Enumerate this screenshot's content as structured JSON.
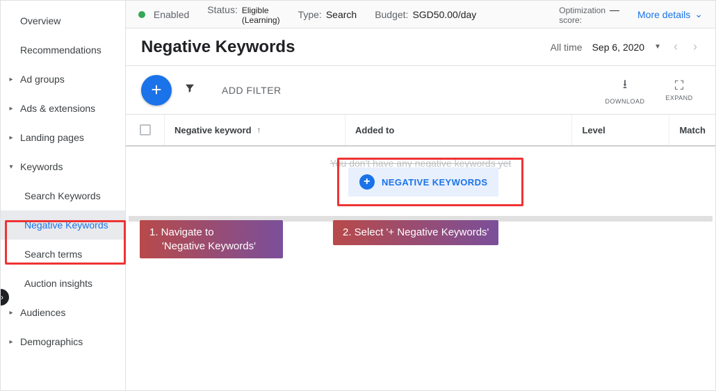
{
  "sidebar": {
    "items": [
      {
        "label": "Overview",
        "chevron": ""
      },
      {
        "label": "Recommendations",
        "chevron": ""
      },
      {
        "label": "Ad groups",
        "chevron": "▸"
      },
      {
        "label": "Ads & extensions",
        "chevron": "▸"
      },
      {
        "label": "Landing pages",
        "chevron": "▸"
      },
      {
        "label": "Keywords",
        "chevron": "▾"
      },
      {
        "label": "Search Keywords",
        "chevron": "",
        "sub": true
      },
      {
        "label": "Negative Keywords",
        "chevron": "",
        "sub": true,
        "active": true
      },
      {
        "label": "Search terms",
        "chevron": "",
        "sub": true
      },
      {
        "label": "Auction insights",
        "chevron": "",
        "sub": true
      },
      {
        "label": "Audiences",
        "chevron": "▸"
      },
      {
        "label": "Demographics",
        "chevron": "▸"
      }
    ]
  },
  "statusbar": {
    "enabled": "Enabled",
    "status_label": "Status:",
    "status_top": "Eligible",
    "status_bottom": "(Learning)",
    "type_label": "Type:",
    "type_value": "Search",
    "budget_label": "Budget:",
    "budget_value": "SGD50.00/day",
    "opt_top": "Optimization",
    "opt_bottom": "score:",
    "opt_dash": "—",
    "more": "More details"
  },
  "header": {
    "title": "Negative Keywords",
    "range_label": "All time",
    "date": "Sep 6, 2020"
  },
  "toolbar": {
    "add_filter": "ADD FILTER",
    "download": "DOWNLOAD",
    "expand": "EXPAND"
  },
  "table": {
    "col1": "Negative keyword",
    "col2": "Added to",
    "col3": "Level",
    "col4": "Match"
  },
  "empty": {
    "message": "You don't have any negative keywords yet",
    "chip": "NEGATIVE KEYWORDS"
  },
  "annotations": {
    "step1_a": "1.  Navigate to",
    "step1_b": "'Negative Keywords'",
    "step2": "2. Select  '+ Negative Keywords'"
  }
}
